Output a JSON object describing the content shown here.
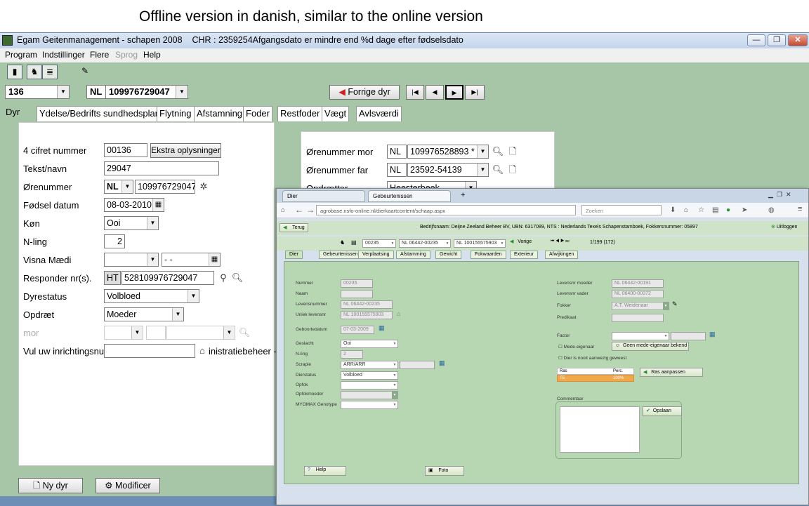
{
  "caption": "Offline version in danish, similar to the online version",
  "desktop": {
    "title": "Egam Geitenmanagement - schapen 2008",
    "title_chr": "CHR : 2359254Afgangsdato er mindre end %d dage efter fødselsdato",
    "menu": [
      "Program",
      "Indstillinger",
      "Flere",
      "Sprog",
      "Help"
    ],
    "animal_number": "136",
    "country": "NL",
    "ear_number": "109976729047",
    "prev_button": "Forrige dyr",
    "nav_buttons": [
      "|◀",
      "◀",
      "▶",
      "▶|"
    ],
    "tabs": [
      "Dyr",
      "Ydelse/Bedrifts sundhedsplan",
      "Flytning",
      "Afstamning",
      "Foder",
      "Restfoder",
      "Vægt",
      "Avlsværdi"
    ],
    "form": {
      "number4_label": "4 cifret nummer",
      "number4": "00136",
      "extra_button": "Ekstra oplysninger",
      "name_label": "Tekst/navn",
      "name": "29047",
      "ear_label": "Ørenummer",
      "ear_country": "NL",
      "ear_value": "109976729047",
      "birth_label": "Fødsel datum",
      "birth": "08-03-2010",
      "sex_label": "Køn",
      "sex": "Ooi",
      "nling_label": "N-ling",
      "nling": "2",
      "visna_label": "Visna Mædi",
      "visna_date": "- -",
      "responder_label": "Responder nr(s).",
      "responder_prefix": "HT",
      "responder": "528109976729047",
      "status_label": "Dyrestatus",
      "status": "Volbloed",
      "breeding_label": "Opdræt",
      "breeding": "Moeder",
      "mor_label": "mor",
      "inrichting_label": "Vul uw inrichtingsnu",
      "inrichting_tail": "inistratiebeheer -"
    },
    "right": {
      "mother_label": "Ørenummer mor",
      "mother_country": "NL",
      "mother_ear": "109976528893 *",
      "father_label": "Ørenummer far",
      "father_country": "NL",
      "father_ear": "23592-54139",
      "breeder_label": "Opdrætter",
      "breeder": "Heesterbeek"
    },
    "new_button": "Ny dyr",
    "modify_button": "Modificer"
  },
  "browser": {
    "tabs": [
      "Dier",
      "Gebeurtenissen",
      "Verplaatsing",
      "Afstamming",
      "Gewicht",
      "Fokwaarden",
      "Exterieur",
      "Afwijkingen"
    ],
    "url": "agrobase.nsfo-online.nl/dierkaartcontent/schaap.aspx",
    "url_host": "nsfo-online.nl",
    "search_placeholder": "Zoeken",
    "back_button": "Terug",
    "company": "Bedrijfsnaam: Deijne Zeeland Beheer BV, UBN: 6317089, NTS : Nederlands Texels Schapenstamboek, Fokkersnummer: 05897",
    "logout_button": "Uitloggen",
    "animal_select": "00235",
    "life_no1": "NL 06442-00235",
    "life_no2": "NL 100155575903",
    "prev_button": "Vorige",
    "counter": "1/199 (172)",
    "left_fields": [
      {
        "label": "Nummer",
        "value": "00235"
      },
      {
        "label": "Naam",
        "value": ""
      },
      {
        "label": "Levensnummer",
        "value": "NL 06442-00235"
      },
      {
        "label": "Uniek levensnr",
        "value": "NL 100155575903"
      },
      {
        "label": "Geboortedatum",
        "value": "07-03-2009"
      },
      {
        "label": "Geslacht",
        "value": "Ooi"
      },
      {
        "label": "N-ling",
        "value": "2"
      },
      {
        "label": "Scrapie",
        "value": "ARR/ARR"
      },
      {
        "label": "Dierstatus",
        "value": "Volbloed"
      },
      {
        "label": "Opfok",
        "value": ""
      },
      {
        "label": "Opfokmoeder",
        "value": ""
      },
      {
        "label": "MYOMAX Genotype",
        "value": ""
      }
    ],
    "right_fields": [
      {
        "label": "Levensnr moeder",
        "value": "NL 06442-00191"
      },
      {
        "label": "Levensnr vader",
        "value": "NL 06400-00372"
      },
      {
        "label": "Fokker",
        "value": "A.T. Weidenaar"
      },
      {
        "label": "Predikaat",
        "value": ""
      }
    ],
    "factor_label": "Factor",
    "mede_label": "Mede-eigenaar",
    "mede_button": "Geen mede-eigenaar bekend",
    "never_present": "Dier is nooit aanwezig geweest",
    "ras_headers": [
      "Ras",
      "Perc."
    ],
    "ras_row": [
      "TE",
      "100%"
    ],
    "ras_button": "Ras aanpassen",
    "comment_label": "Commentaar",
    "save_button": "Opslaan",
    "help_button": "Help",
    "photo_button": "Foto"
  }
}
